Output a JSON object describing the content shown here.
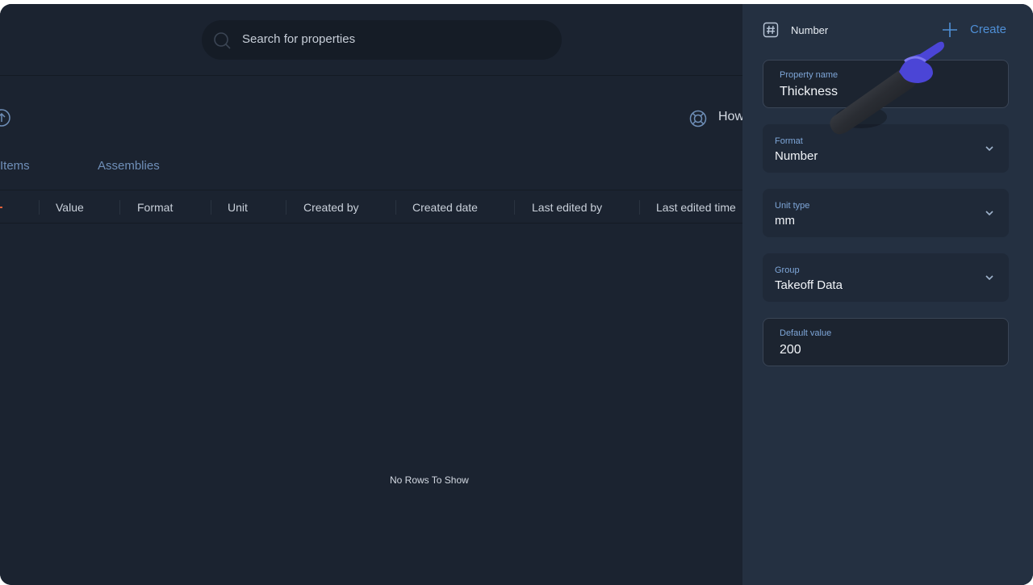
{
  "search": {
    "placeholder": "Search for properties"
  },
  "toolbar": {
    "help_label": "How"
  },
  "tabs": [
    {
      "label": "Items"
    },
    {
      "label": "Assemblies"
    }
  ],
  "table": {
    "columns": [
      "Value",
      "Format",
      "Unit",
      "Created by",
      "Created date",
      "Last edited by",
      "Last edited time"
    ],
    "empty_message": "No Rows To Show"
  },
  "panel": {
    "type_label": "Number",
    "create_label": "Create",
    "fields": [
      {
        "label": "Property name",
        "value": "Thickness"
      },
      {
        "label": "Format",
        "value": "Number"
      },
      {
        "label": "Unit type",
        "value": "mm"
      },
      {
        "label": "Group",
        "value": "Takeoff Data"
      },
      {
        "label": "Default value",
        "value": "200"
      }
    ]
  },
  "colors": {
    "background": "#1b2330",
    "panel": "#243041",
    "accent": "#4f8fd6",
    "tab": "#6f8fb8"
  },
  "icons": [
    "search-icon",
    "upload-icon",
    "help-icon",
    "hash-icon",
    "plus-icon",
    "chevron-down-icon",
    "hand-pointer-icon"
  ]
}
